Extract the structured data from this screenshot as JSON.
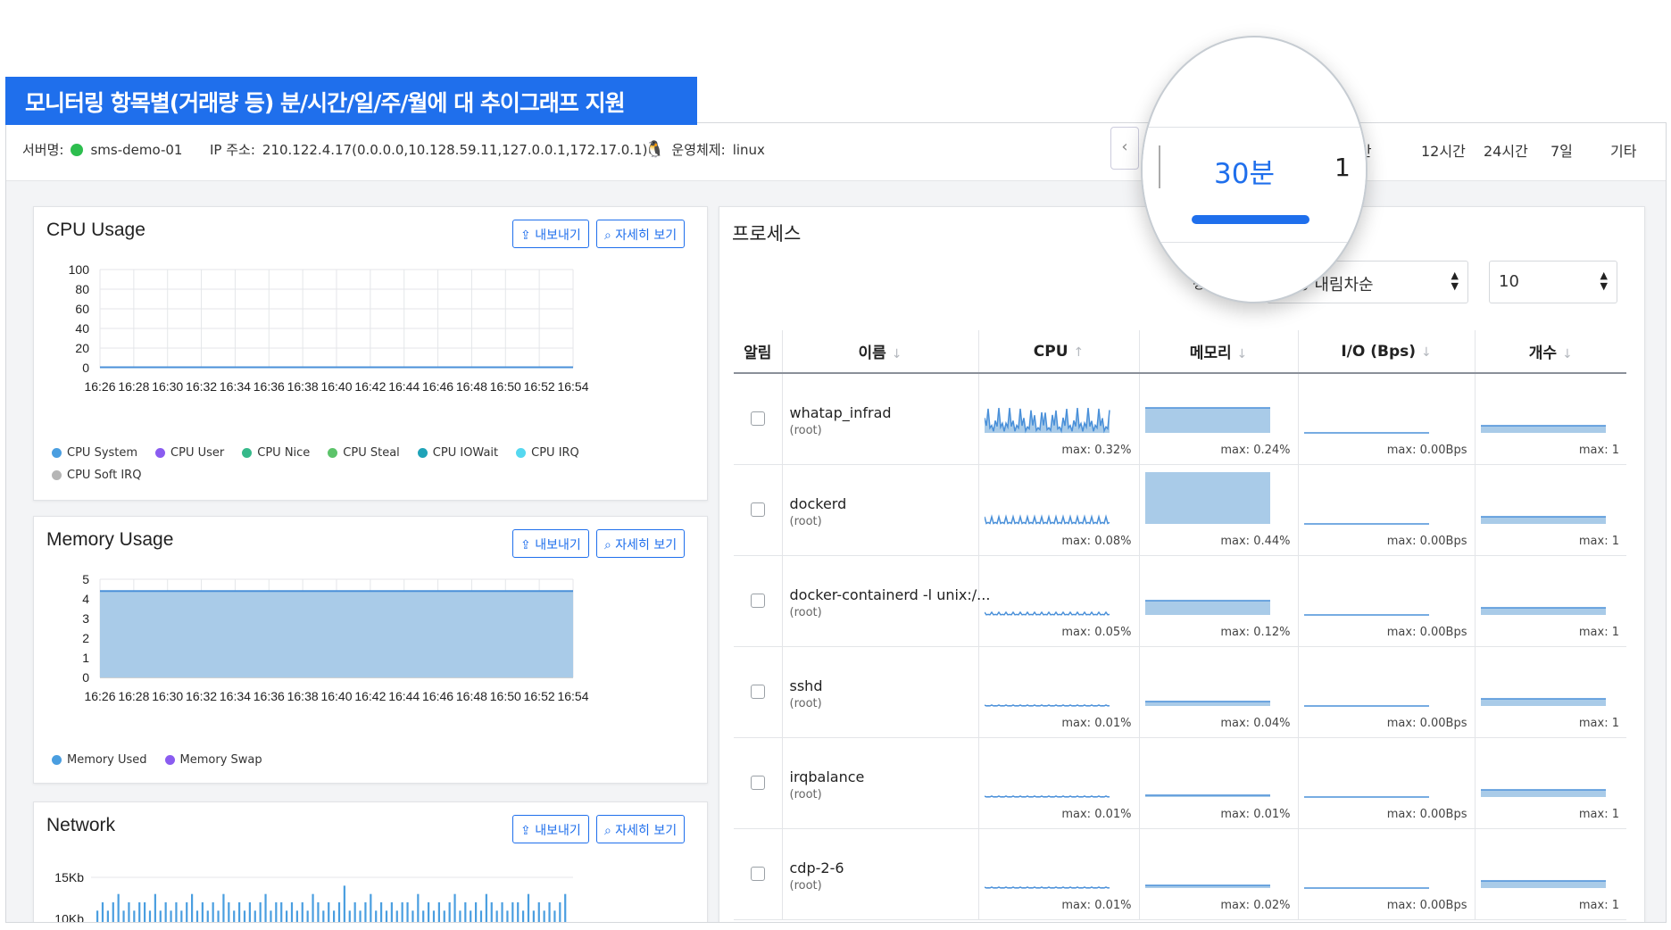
{
  "banner": {
    "text": "모니터링 항목별(거래량 등) 분/시간/일/주/월에 대 추이그래프 지원"
  },
  "server": {
    "name_label": "서버명:",
    "name_value": "sms-demo-01",
    "ip_label": "IP 주소:",
    "ip_value": "210.122.4.17(0.0.0.0,10.128.59.11,127.0.0.1,172.17.0.1)",
    "os_label": "운영체제:",
    "os_value": "linux"
  },
  "time_tabs": {
    "collapse": "‹",
    "pin": "|",
    "active": "30분",
    "t1": "1시간",
    "t12": "12시간",
    "t24": "24시간",
    "d7": "7일",
    "etc": "기타"
  },
  "buttons": {
    "export": "내보내기",
    "detail": "자세히 보기"
  },
  "cpu_panel": {
    "title": "CPU Usage",
    "legend": [
      "CPU System",
      "CPU User",
      "CPU Nice",
      "CPU Steal",
      "CPU IOWait",
      "CPU IRQ",
      "CPU Soft IRQ"
    ]
  },
  "memory_panel": {
    "title": "Memory Usage",
    "legend": [
      "Memory Used",
      "Memory Swap"
    ]
  },
  "network_panel": {
    "title": "Network"
  },
  "process_panel": {
    "title": "프로세스",
    "sort_label": "정렬 순서",
    "sort_value": "CPU 내림차순",
    "count_value": "10",
    "headers": {
      "alarm": "알림",
      "name": "이름",
      "cpu": "CPU",
      "memory": "메모리",
      "io": "I/O (Bps)",
      "count": "개수"
    },
    "sort_arrows": {
      "name": "↓",
      "cpu": "↑",
      "memory": "↓",
      "io": "↓",
      "count": "↓"
    },
    "rows": [
      {
        "name": "whatap_infrad",
        "user": "(root)",
        "cpu_max": "max: 0.32%",
        "mem_max": "max: 0.24%",
        "io_max": "max: 0.00Bps",
        "count_max": "max: 1"
      },
      {
        "name": "dockerd",
        "user": "(root)",
        "cpu_max": "max: 0.08%",
        "mem_max": "max: 0.44%",
        "io_max": "max: 0.00Bps",
        "count_max": "max: 1"
      },
      {
        "name": "docker-containerd -l unix:/...",
        "user": "(root)",
        "cpu_max": "max: 0.05%",
        "mem_max": "max: 0.12%",
        "io_max": "max: 0.00Bps",
        "count_max": "max: 1"
      },
      {
        "name": "sshd",
        "user": "(root)",
        "cpu_max": "max: 0.01%",
        "mem_max": "max: 0.04%",
        "io_max": "max: 0.00Bps",
        "count_max": "max: 1"
      },
      {
        "name": "irqbalance",
        "user": "(root)",
        "cpu_max": "max: 0.01%",
        "mem_max": "max: 0.01%",
        "io_max": "max: 0.00Bps",
        "count_max": "max: 1"
      },
      {
        "name": "cdp-2-6",
        "user": "(root)",
        "cpu_max": "max: 0.01%",
        "mem_max": "max: 0.02%",
        "io_max": "max: 0.00Bps",
        "count_max": "max: 1"
      }
    ]
  },
  "colors": {
    "accent": "#1f6fec",
    "area_fill": "#a9cbe8",
    "area_line": "#4a90d9",
    "cpu_system": "#4a9ee0",
    "cpu_user": "#8a5cf0",
    "cpu_nice": "#36b98a",
    "cpu_steal": "#5cc36a",
    "cpu_iowait": "#1fa3b8",
    "cpu_irq": "#55d8f0",
    "cpu_softirq": "#b5b5b5",
    "mem_used": "#4a9ee0",
    "mem_swap": "#8a5cf0"
  },
  "chart_data": [
    {
      "type": "line",
      "title": "CPU Usage",
      "x": [
        "16:26",
        "16:28",
        "16:30",
        "16:32",
        "16:34",
        "16:36",
        "16:38",
        "16:40",
        "16:42",
        "16:44",
        "16:46",
        "16:48",
        "16:50",
        "16:52",
        "16:54"
      ],
      "y_ticks": [
        0,
        20,
        40,
        60,
        80,
        100
      ],
      "ylim": [
        0,
        100
      ],
      "series": [
        {
          "name": "CPU System",
          "values": [
            0.4,
            0.5,
            0.4,
            0.5,
            0.4,
            0.5,
            0.4,
            0.5,
            0.4,
            0.5,
            0.4,
            0.5,
            0.4,
            0.5,
            0.4
          ]
        },
        {
          "name": "CPU User",
          "values": [
            0.3,
            0.3,
            0.3,
            0.3,
            0.3,
            0.3,
            0.3,
            0.3,
            0.3,
            0.3,
            0.3,
            0.3,
            0.3,
            0.3,
            0.3
          ]
        },
        {
          "name": "CPU Nice",
          "values": [
            0,
            0,
            0,
            0,
            0,
            0,
            0,
            0,
            0,
            0,
            0,
            0,
            0,
            0,
            0
          ]
        },
        {
          "name": "CPU Steal",
          "values": [
            0,
            0,
            0,
            0,
            0,
            0,
            0,
            0,
            0,
            0,
            0,
            0,
            0,
            0,
            0
          ]
        },
        {
          "name": "CPU IOWait",
          "values": [
            0,
            0,
            0,
            0,
            0,
            0,
            0,
            0,
            0,
            0,
            0,
            0,
            0,
            0,
            0
          ]
        },
        {
          "name": "CPU IRQ",
          "values": [
            0,
            0,
            0,
            0,
            0,
            0,
            0,
            0,
            0,
            0,
            0,
            0,
            0,
            0,
            0
          ]
        },
        {
          "name": "CPU Soft IRQ",
          "values": [
            0,
            0,
            0,
            0,
            0,
            0,
            0,
            0,
            0,
            0,
            0,
            0,
            0,
            0,
            0
          ]
        }
      ],
      "grid": true,
      "legend": "bottom"
    },
    {
      "type": "area",
      "title": "Memory Usage",
      "x": [
        "16:26",
        "16:28",
        "16:30",
        "16:32",
        "16:34",
        "16:36",
        "16:38",
        "16:40",
        "16:42",
        "16:44",
        "16:46",
        "16:48",
        "16:50",
        "16:52",
        "16:54"
      ],
      "y_ticks": [
        0,
        1,
        2,
        3,
        4,
        5
      ],
      "ylim": [
        0,
        5
      ],
      "series": [
        {
          "name": "Memory Used",
          "values": [
            4.4,
            4.4,
            4.4,
            4.4,
            4.4,
            4.4,
            4.4,
            4.4,
            4.4,
            4.4,
            4.4,
            4.4,
            4.4,
            4.4,
            4.4
          ]
        },
        {
          "name": "Memory Swap",
          "values": [
            0,
            0,
            0,
            0,
            0,
            0,
            0,
            0,
            0,
            0,
            0,
            0,
            0,
            0,
            0
          ]
        }
      ],
      "grid": true,
      "legend": "bottom"
    },
    {
      "type": "bar",
      "title": "Network",
      "y_ticks": [
        "10Kb",
        "15Kb"
      ],
      "values": [
        11,
        12,
        11,
        12,
        13,
        11,
        12,
        11,
        12,
        12,
        11,
        13,
        11,
        12,
        11,
        12,
        11,
        12,
        13,
        11,
        12,
        11,
        12,
        11,
        13,
        12,
        11,
        12,
        11,
        12,
        11,
        12,
        13,
        11,
        12,
        12,
        11,
        12,
        11,
        12,
        11,
        13,
        12,
        11,
        12,
        11,
        12,
        14,
        11,
        12,
        11,
        12,
        13,
        11,
        12,
        11,
        12,
        11,
        12,
        12,
        11,
        13,
        11,
        12,
        11,
        12,
        11,
        12,
        13,
        11,
        12,
        11,
        12,
        11,
        13,
        12,
        11,
        12,
        11,
        12,
        12,
        11,
        13,
        11,
        12,
        11,
        12,
        11,
        12,
        13
      ],
      "legend": "none"
    }
  ]
}
